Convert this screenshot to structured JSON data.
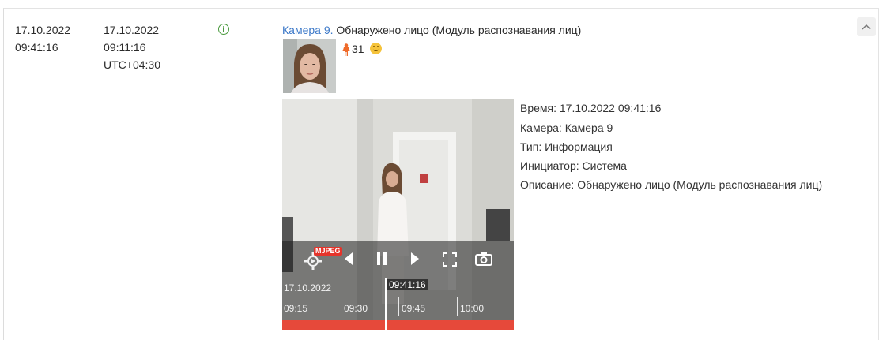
{
  "event": {
    "server_date": "17.10.2022",
    "server_time": "09:41:16",
    "local_date": "17.10.2022",
    "local_time": "09:11:16",
    "timezone": "UTC+04:30",
    "camera_link": "Камера 9.",
    "title": "Обнаружено лицо (Модуль распознавания лиц)",
    "age": "31",
    "gender_icon": "female-person-icon",
    "emotion_icon": "smile-emoji-icon",
    "status_icon": "info-icon",
    "status_color": "#4a9a3e"
  },
  "details": {
    "time": "Время: 17.10.2022 09:41:16",
    "camera": "Камера: Камера 9",
    "type": "Тип: Информация",
    "initiator": "Инициатор: Система",
    "description": "Описание: Обнаружено лицо (Модуль распознавания лиц)"
  },
  "player": {
    "codec_badge": "MJPEG",
    "date": "17.10.2022",
    "current_time": "09:41:16",
    "ticks": [
      "09:15",
      "09:30",
      "09:45",
      "10:00"
    ],
    "accent_color": "#e6493a"
  }
}
